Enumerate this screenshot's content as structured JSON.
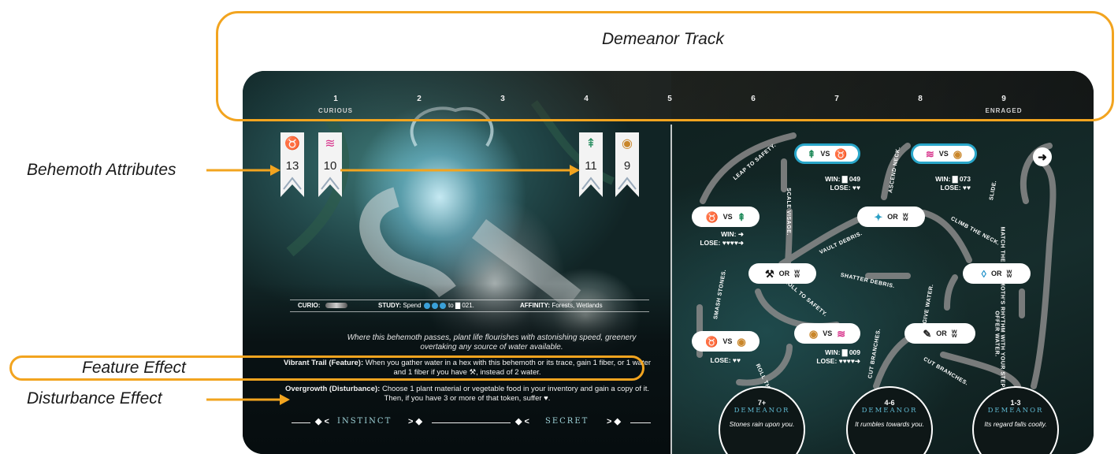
{
  "annotations": {
    "track_title": "Demeanor Track",
    "attributes": "Behemoth Attributes",
    "feature": "Feature Effect",
    "disturbance": "Disturbance Effect"
  },
  "colors": {
    "annotation": "#f2a41f",
    "vs_border": "#29a6c9",
    "demeanor_text": "#5fb8d0"
  },
  "track": {
    "steps": [
      "1",
      "2",
      "3",
      "4",
      "5",
      "6",
      "7",
      "8",
      "9"
    ],
    "start_label": "CURIOUS",
    "end_label": "ENRAGED"
  },
  "attributes": [
    {
      "icon": "fox-icon",
      "glyph": "♉",
      "color": "#ef8a1e",
      "value": "13"
    },
    {
      "icon": "water-waves-icon",
      "glyph": "≋",
      "color": "#d7318a",
      "value": "10"
    },
    {
      "icon": "tree-icon",
      "glyph": "⇞",
      "color": "#1f8a5a",
      "value": "11"
    },
    {
      "icon": "eye-icon",
      "glyph": "◉",
      "color": "#c9862a",
      "value": "9"
    }
  ],
  "curio": {
    "curio_label": "CURIO:",
    "study_label": "STUDY:",
    "study_text_1": "Spend",
    "study_text_2": "to",
    "study_ref": "021.",
    "affinity_label": "AFFINITY:",
    "affinity_value": "Forests, Wetlands"
  },
  "flavor": "Where this behemoth passes, plant life flourishes with astonishing speed, greenery overtaking any source of water available.",
  "feature_rule": {
    "name": "Vibrant Trail (Feature):",
    "text": "When you gather water in a hex with this behemoth or its trace, gain 1 fiber, or 1 water and 1 fiber if you have",
    "text_end": ", instead of 2 water."
  },
  "disturbance_rule": {
    "name": "Overgrowth (Disturbance):",
    "text": "Choose 1 plant material or vegetable food in your inventory and gain a copy of it. Then, if you have 3 or more of that token, suffer"
  },
  "instinct": {
    "left": "INSTINCT",
    "right": "SECRET"
  },
  "flow": {
    "vs": "VS",
    "or": "OR",
    "win": "WIN:",
    "lose": "LOSE:",
    "result_049": "049",
    "result_073": "073",
    "result_009": "009",
    "labels": {
      "leap": "LEAP TO SAFETY.",
      "scale": "SCALE VISAGE.",
      "ascend": "ASCEND NECK.",
      "vault": "VAULT DEBRIS.",
      "climb": "CLIMB THE NECK.",
      "slide": "SLIDE.",
      "match": "MATCH THE BEHEMOTH'S RHYTHM WITH YOUR STEPS.",
      "smash": "SMASH STONES.",
      "roll_safety": "ROLL TO SAFETY.",
      "shatter": "SHATTER DEBRIS.",
      "give": "GIVE WATER.",
      "offer": "OFFER WATER.",
      "roll_through": "ROLL THROUGH.",
      "cut": "CUT BRANCHES.",
      "cut2": "CUT BRANCHES."
    }
  },
  "demeanor": [
    {
      "range": "7+",
      "word": "DEMEANOR",
      "desc": "Stones rain upon you."
    },
    {
      "range": "4-6",
      "word": "DEMEANOR",
      "desc": "It rumbles towards you."
    },
    {
      "range": "1-3",
      "word": "DEMEANOR",
      "desc": "Its regard falls coolly."
    }
  ]
}
